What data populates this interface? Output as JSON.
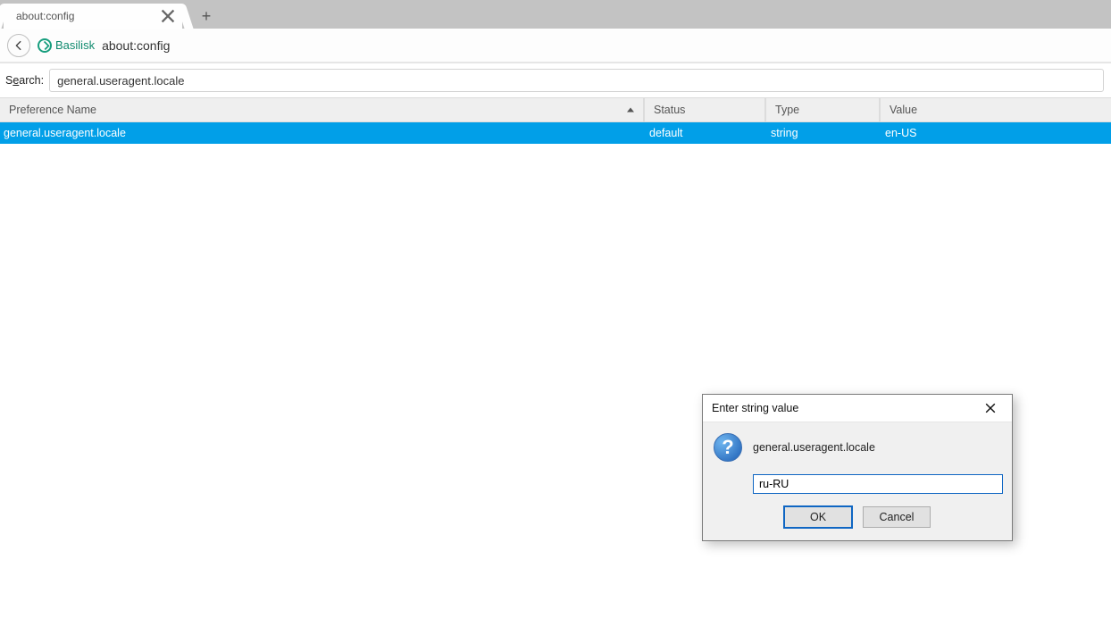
{
  "tab": {
    "title": "about:config"
  },
  "nav": {
    "identity_label": "Basilisk",
    "url": "about:config"
  },
  "search": {
    "label_full": "Search:",
    "value": "general.useragent.locale"
  },
  "columns": {
    "name": "Preference Name",
    "status": "Status",
    "type": "Type",
    "value": "Value"
  },
  "rows": [
    {
      "name": "general.useragent.locale",
      "status": "default",
      "type": "string",
      "value": "en-US"
    }
  ],
  "dialog": {
    "title": "Enter string value",
    "pref_name": "general.useragent.locale",
    "input_value": "ru-RU",
    "ok_label": "OK",
    "cancel_label": "Cancel"
  }
}
